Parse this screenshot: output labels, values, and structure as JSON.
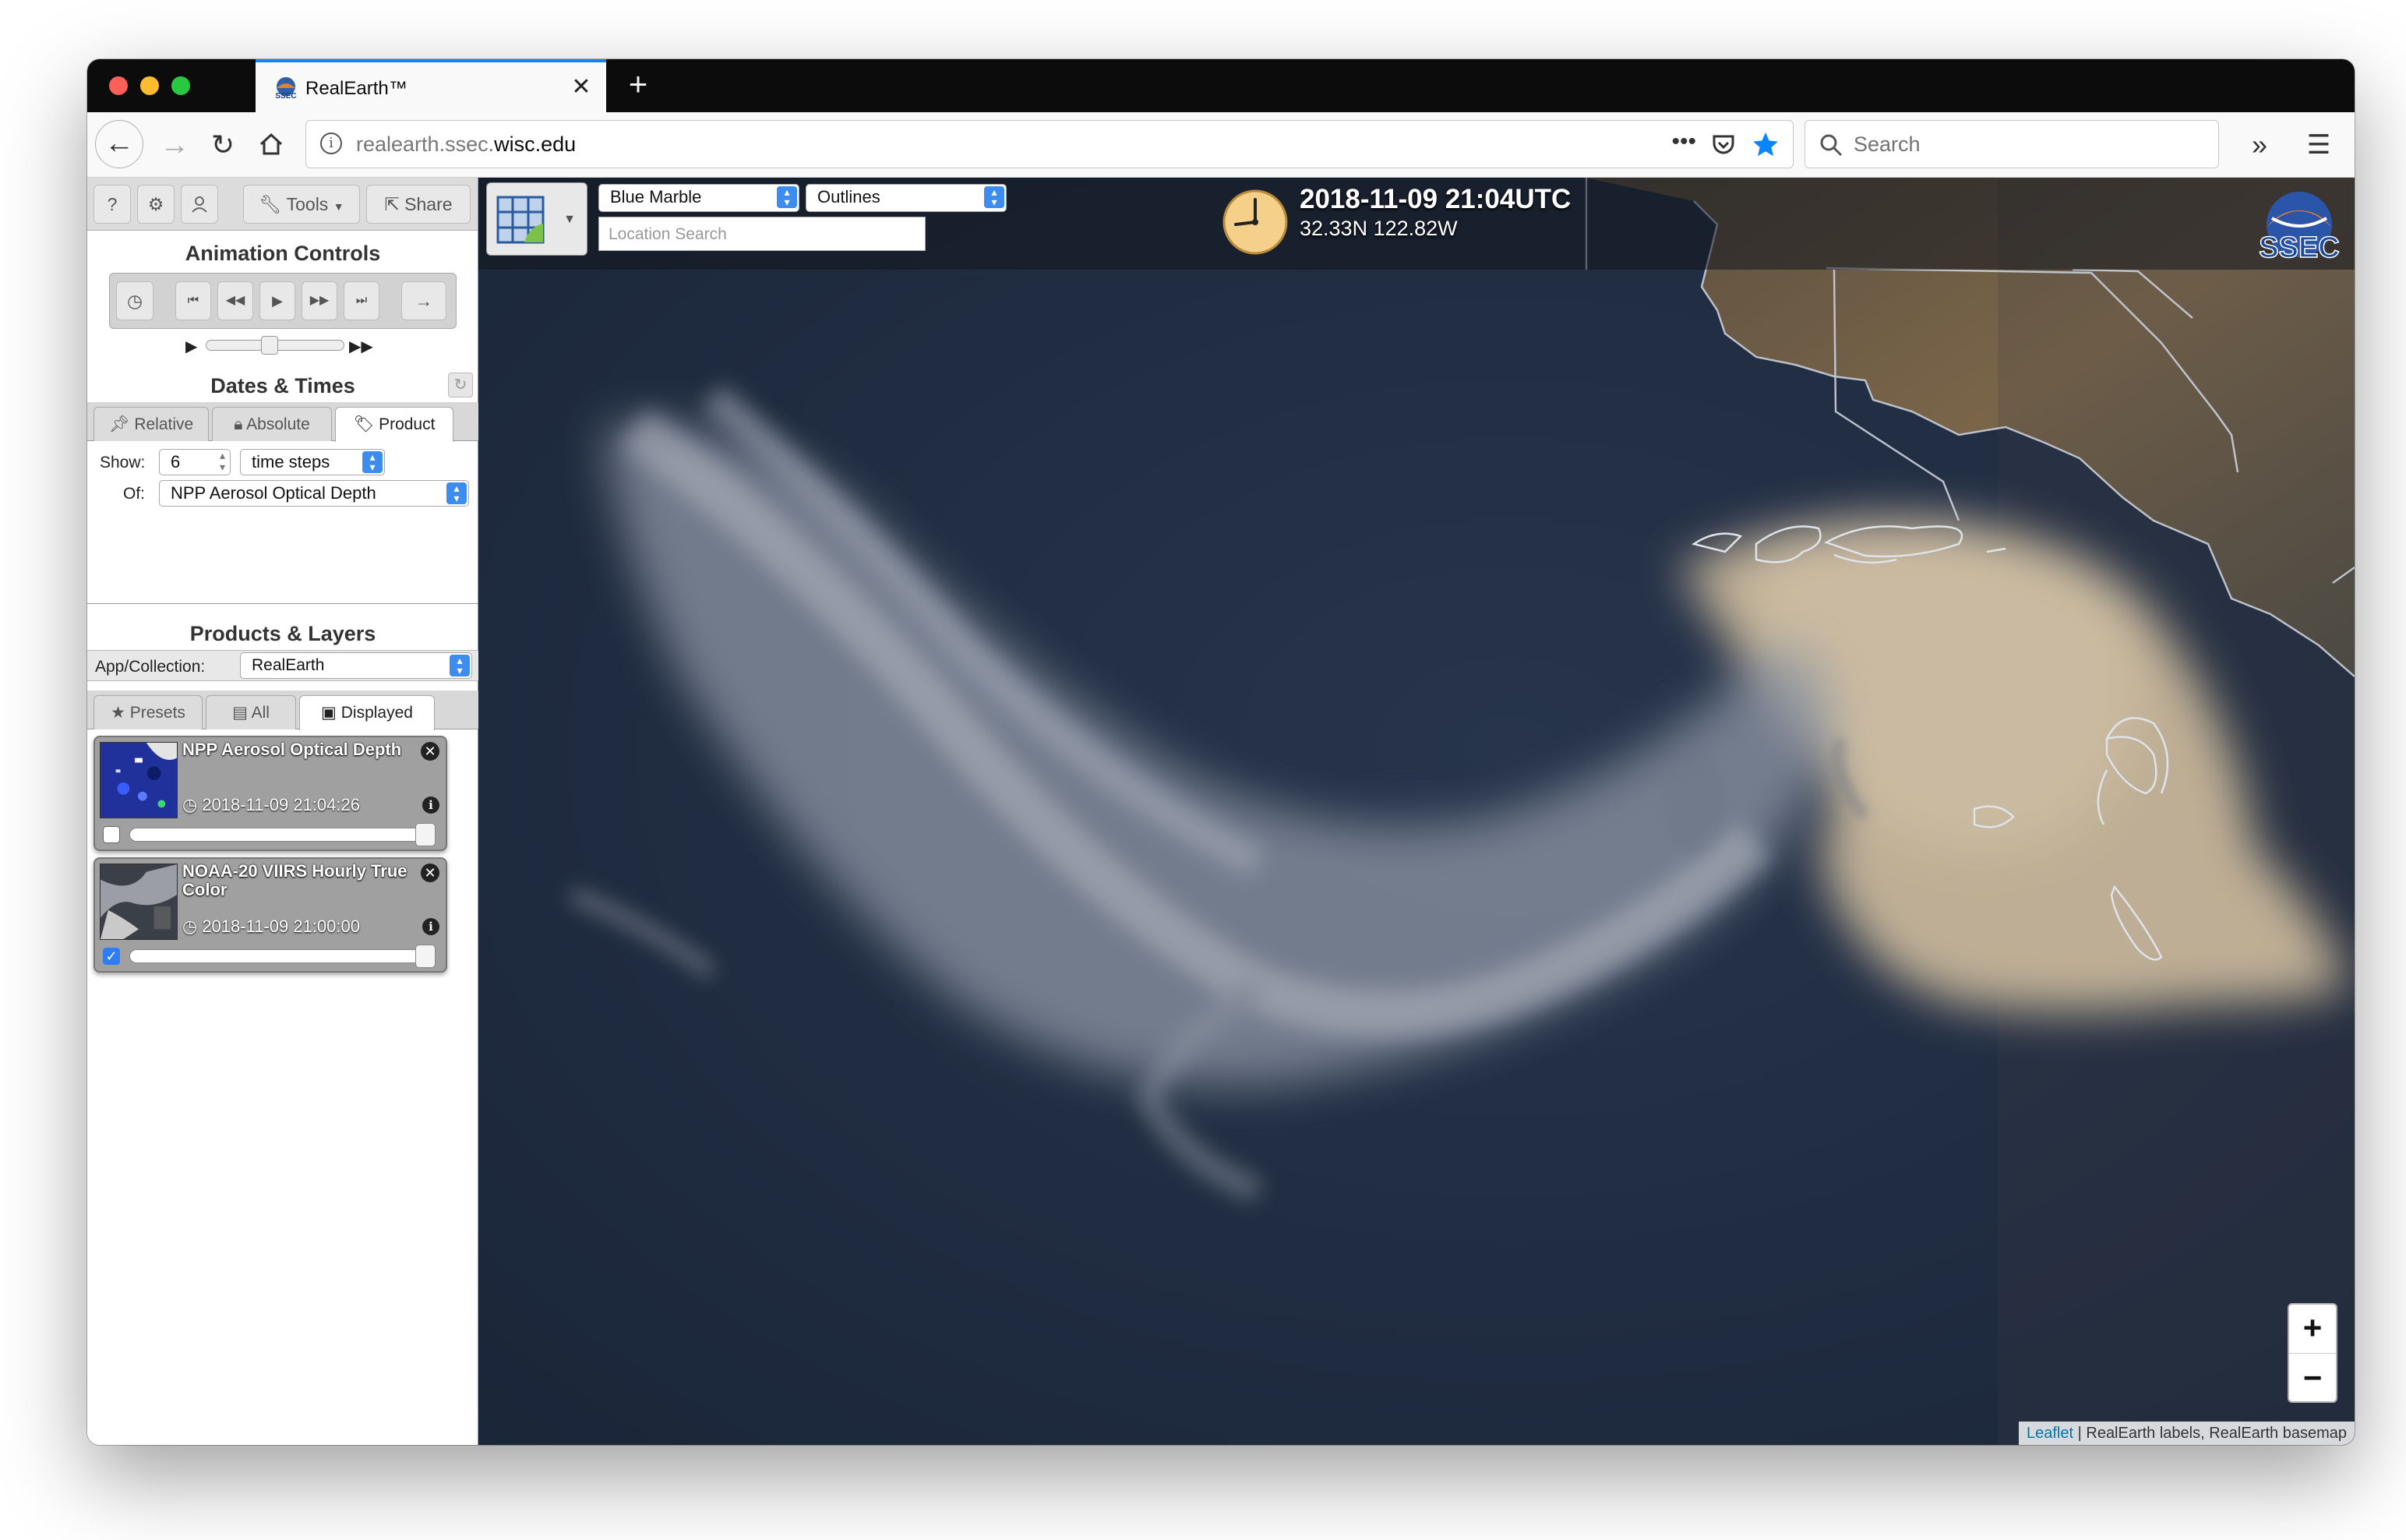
{
  "browser": {
    "tab_title": "RealEarth™",
    "url_host_prefix": "realearth.ssec.",
    "url_host_domain": "wisc.edu",
    "search_placeholder": "Search"
  },
  "sidebar": {
    "toolbar": {
      "help": "?",
      "settings": "⚙",
      "user": "👤",
      "tools": "Tools",
      "share": "Share"
    },
    "animation_title": "Animation Controls",
    "dates_title": "Dates & Times",
    "date_tabs": [
      "Relative",
      "Absolute",
      "Product"
    ],
    "show_label": "Show:",
    "show_value": "6",
    "show_unit": "time steps",
    "of_label": "Of:",
    "of_value": "NPP Aerosol Optical Depth",
    "products_title": "Products & Layers",
    "app_label": "App/Collection:",
    "app_value": "RealEarth",
    "layer_tabs": [
      "Presets",
      "All",
      "Displayed"
    ],
    "layers": [
      {
        "title": "NPP Aerosol Optical Depth",
        "time": "2018-11-09 21:04:26",
        "checked": false
      },
      {
        "title": "NOAA-20 VIIRS Hourly True Color",
        "time": "2018-11-09 21:00:00",
        "checked": true
      }
    ]
  },
  "map": {
    "basemap": "Blue Marble",
    "overlay": "Outlines",
    "location_placeholder": "Location Search",
    "datetime": "2018-11-09 21:04UTC",
    "coords": "32.33N 122.82W",
    "logo": "SSEC",
    "zoom_in": "+",
    "zoom_out": "−",
    "attribution_link": "Leaflet",
    "attribution_text": " | RealEarth labels, RealEarth basemap"
  },
  "colors": {
    "accent": "#3d8cf0",
    "ocean": "#1d2a40",
    "smoke": "#c9b79c",
    "land": "#6b5a43",
    "clock": "#f5d08a"
  }
}
